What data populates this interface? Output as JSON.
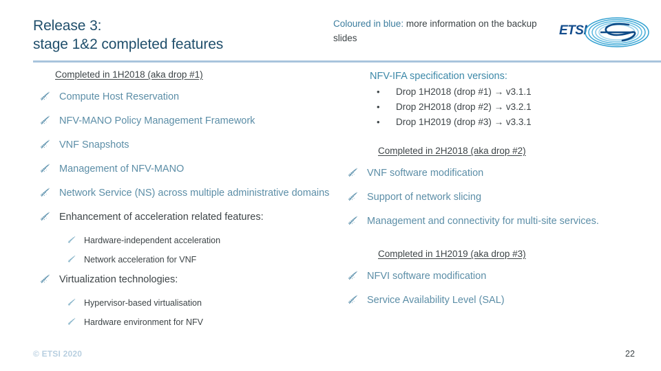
{
  "slide": {
    "title_line1": "Release 3:",
    "title_line2": "stage 1&2 completed features",
    "header_note_highlight": "Coloured in blue:",
    "header_note_rest": " more information on the backup slides",
    "logo_text": "ETSI",
    "copyright": "© ETSI 2020",
    "page_number": "22"
  },
  "left_column": {
    "heading": "Completed in 1H2018 (aka drop #1)",
    "items": [
      {
        "text": "Compute Host Reservation",
        "level": 1,
        "style": "blue"
      },
      {
        "text": "NFV-MANO Policy Management Framework",
        "level": 1,
        "style": "blue"
      },
      {
        "text": "VNF Snapshots",
        "level": 1,
        "style": "blue"
      },
      {
        "text": "Management of NFV-MANO",
        "level": 1,
        "style": "blue"
      },
      {
        "text": "Network Service (NS) across multiple administrative domains",
        "level": 1,
        "style": "blue"
      },
      {
        "text": "Enhancement of acceleration related features:",
        "level": 1,
        "style": "dark"
      },
      {
        "text": "Hardware-independent acceleration",
        "level": 2,
        "style": "dark"
      },
      {
        "text": "Network acceleration for VNF",
        "level": 2,
        "style": "dark"
      },
      {
        "text": "Virtualization technologies:",
        "level": 1,
        "style": "dark"
      },
      {
        "text": "Hypervisor-based virtualisation",
        "level": 2,
        "style": "dark"
      },
      {
        "text": "Hardware environment for NFV",
        "level": 2,
        "style": "dark"
      }
    ]
  },
  "right_column": {
    "versions_heading": "NFV-IFA specification versions:",
    "versions": [
      "Drop 1H2018 (drop #1) → v3.1.1",
      "Drop 2H2018 (drop #2) → v3.2.1",
      "Drop 1H2019 (drop #3) → v3.3.1"
    ],
    "drop2_heading": "Completed in 2H2018 (aka drop #2)",
    "drop2_items": [
      {
        "text": "VNF software modification",
        "style": "blue"
      },
      {
        "text": "Support of network slicing",
        "style": "blue"
      },
      {
        "text": "Management and connectivity for multi-site services.",
        "style": "blue"
      }
    ],
    "drop3_heading": "Completed in 1H2019 (aka drop #3)",
    "drop3_items": [
      {
        "text": "NFVI software modification",
        "style": "blue"
      },
      {
        "text": "Service Availability Level (SAL)",
        "style": "blue"
      }
    ]
  },
  "colors": {
    "title_blue": "#1f4e6b",
    "bullet_blue": "#5c8ea7",
    "body_dark": "#3d4447",
    "divider": "#a8c4dc",
    "accent_teal": "#3c88a8",
    "copyright": "#b8cfe0"
  }
}
